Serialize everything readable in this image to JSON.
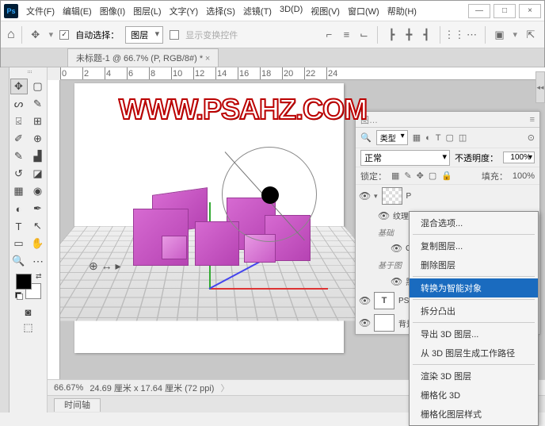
{
  "menus": [
    "文件(F)",
    "编辑(E)",
    "图像(I)",
    "图层(L)",
    "文字(Y)",
    "选择(S)",
    "滤镜(T)",
    "3D(D)",
    "视图(V)",
    "窗口(W)",
    "帮助(H)"
  ],
  "winbtns": {
    "min": "—",
    "max": "□",
    "close": "×"
  },
  "optbar": {
    "auto_select": "自动选择：",
    "layer_sel": "图层",
    "show_transform": "显示变换控件",
    "checked": "✓"
  },
  "tab": "未标题-1 @ 66.7% (P, RGB/8#) *",
  "ruler_nums": [
    "0",
    "2",
    "4",
    "6",
    "8",
    "10",
    "12",
    "14",
    "16",
    "18",
    "20",
    "22",
    "24"
  ],
  "watermark": "WWW.PSAHZ.COM",
  "status": {
    "zoom": "66.67%",
    "dims": "24.69 厘米 x 17.64 厘米 (72 ppi)"
  },
  "timeline": "时间轴",
  "layers": {
    "type_filter": "类型",
    "blend": "正常",
    "opacity_label": "不透明度：",
    "opacity": "100%",
    "lock_label": "锁定：",
    "fill_label": "填充：",
    "fill": "100%",
    "l_p": "P",
    "l_wenli": "纹理",
    "l_jichu": "基础",
    "l_c": "C",
    "l_jiyu": "基于图",
    "l_hei": "黑",
    "l_psahz": "PSAH",
    "l_bg": "背景"
  },
  "ctx": [
    "混合选项...",
    "-",
    "复制图层...",
    "删除图层",
    "-",
    "转换为智能对象",
    "-",
    "拆分凸出",
    "-",
    "导出 3D 图层...",
    "从 3D 图层生成工作路径",
    "-",
    "渲染 3D 图层",
    "栅格化 3D",
    "栅格化图层样式"
  ],
  "ctx_hl": "转换为智能对象"
}
